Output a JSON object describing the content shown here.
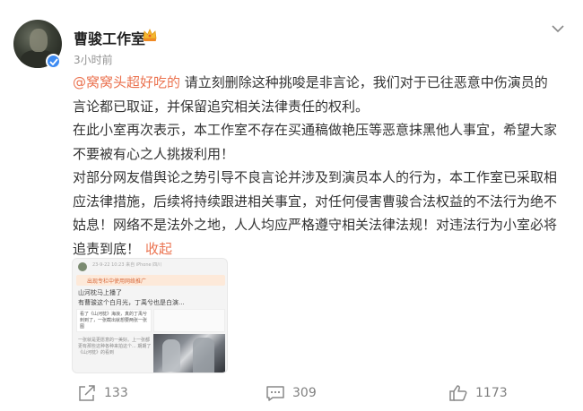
{
  "post": {
    "username": "曹骏工作室",
    "time": "3小时前",
    "mention": "@窝窝头超好吃的",
    "lines": [
      " 请立刻删除这种挑唆是非言论，我们对于已往恶意中伤演员的",
      "言论都已取证，并保留追究相关法律责任的权利。",
      "在此小室再次表示，本工作室不存在买通稿做艳压等恶意抹黑他人事宜，希望大家",
      "不要被有心之人挑拨利用！",
      "对部分网友借舆论之势引导不良言论并涉及到演员本人的行为，本工作室已采取相",
      "应法律措施，后续将持续跟进相关事宜，对任何侵害曹骏合法权益的不法行为绝不",
      "姑息！网络不是法外之地，人人均应严格遵守相关法律法规！对违法行为小室必将",
      "追责到底！"
    ],
    "collapse": "收起"
  },
  "thumbnail": {
    "meta": "23-9-22 10:23  来自 iPhone  四川",
    "bar": "出现专栏中使用网络推广",
    "line1": "山河枕马上播了",
    "line2": "有曹骏这个白月光，丁禹兮也是白演...",
    "card": "看了《山河枕》海浪，真的丁禹兮刺到了，一张截出就想要两张一张图",
    "text3": "一张就是更愿意的一美好。上一张都更有那些这种各种来拍这个... 期期了《山河枕》的看到"
  },
  "actions": {
    "share": "133",
    "comment": "309",
    "like": "1173"
  },
  "colors": {
    "accent": "#eb7350",
    "verify": "#3d8bf2",
    "meta": "#939393"
  }
}
